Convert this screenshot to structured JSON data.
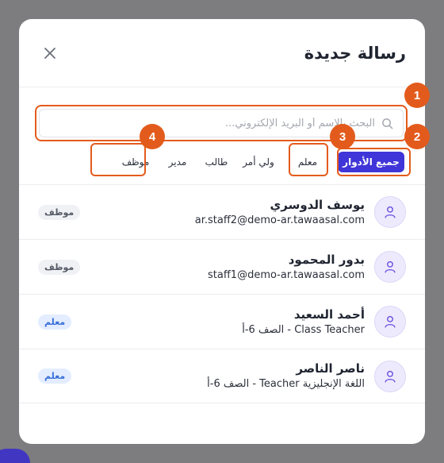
{
  "modal": {
    "title": "رسالة جديدة",
    "close_icon": "close-icon"
  },
  "search": {
    "placeholder": "البحث بالاسم أو البريد الإلكتروني...",
    "value": "",
    "icon": "search-icon"
  },
  "filters": [
    {
      "label": "جميع الأدوار",
      "active": true
    },
    {
      "label": "معلم",
      "active": false
    },
    {
      "label": "ولي أمر",
      "active": false
    },
    {
      "label": "طالب",
      "active": false
    },
    {
      "label": "مدير",
      "active": false
    },
    {
      "label": "موظف",
      "active": false
    }
  ],
  "annotations": [
    "1",
    "2",
    "3",
    "4"
  ],
  "contacts": [
    {
      "name": "يوسف الدوسري",
      "detail": "ar.staff2@demo-ar.tawaasal.com",
      "role": "موظف",
      "role_type": "staff"
    },
    {
      "name": "بدور المحمود",
      "detail": "staff1@demo-ar.tawaasal.com",
      "role": "موظف",
      "role_type": "staff"
    },
    {
      "name": "أحمد السعيد",
      "detail": "Class Teacher - الصف 6-أ",
      "role": "معلم",
      "role_type": "teacher"
    },
    {
      "name": "ناصر الناصر",
      "detail": "اللغة الإنجليزية Teacher - الصف 6-أ",
      "role": "معلم",
      "role_type": "teacher"
    }
  ],
  "colors": {
    "accent": "#3f35d8",
    "highlight": "#e35b1c",
    "teacher_tag_bg": "#e3edff",
    "staff_tag_bg": "#f0f1f4"
  }
}
